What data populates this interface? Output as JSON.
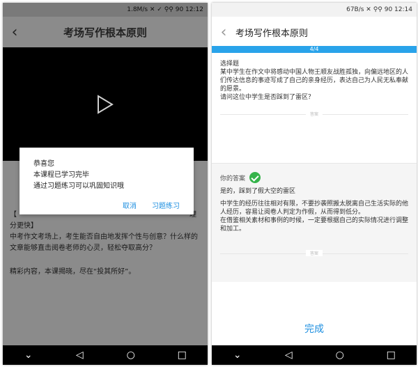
{
  "left": {
    "status": "1.8M/s ✕ ✓ ⚲⚲ 90 12:12",
    "header_title": "考场写作根本原则",
    "back_icon": "chevron-left-icon",
    "play_icon": "play-icon",
    "summary_open": "【",
    "summary_tail": "理",
    "summary_line2": "分更快】",
    "desc": "中考作文考场上，考生能否自由地发挥个性与创意？什么样的文章能够直击阅卷老师的心灵，轻松夺取高分？",
    "more": "精彩内容，本课揭晓，尽在“投其所好”。",
    "dialog": {
      "title": "恭喜您",
      "line1": "本课程已学习完毕",
      "line2": "通过习题练习可以巩固知识哦",
      "cancel": "取消",
      "exercise": "习题练习"
    }
  },
  "right": {
    "status": "67B/s ✕ ⚲⚲ 90 12:14",
    "header_title": "考场写作根本原则",
    "back_icon": "chevron-left-icon",
    "progress": "4/4",
    "question_type": "选择题",
    "question": "某中学生在作文中将感动中国人物王顺友战胜孤独，向偏远地区的人们传达信息的事迹写成了自己的亲身经历，表达自己为人民无私奉献的愿景。",
    "question_ask": "请问这位中学生是否踩到了雷区？",
    "divider1": "答案",
    "answer_label": "你的答案",
    "answer_main": "是的，踩到了假大空的雷区",
    "explain1": "中学生的经历往往相对有限，不要抄袭照搬太脱离自己生活实际的他人经历，容易让阅卷人判定为作假，从而得到低分。",
    "explain2": "在借鉴相关素材和事例的时候，一定要根据自己的实际情况进行调整和加工。",
    "divider2": "答案",
    "finish": "完成"
  },
  "nav": {
    "down": "⌄",
    "back": "◁",
    "home": "○",
    "recent": "□"
  }
}
